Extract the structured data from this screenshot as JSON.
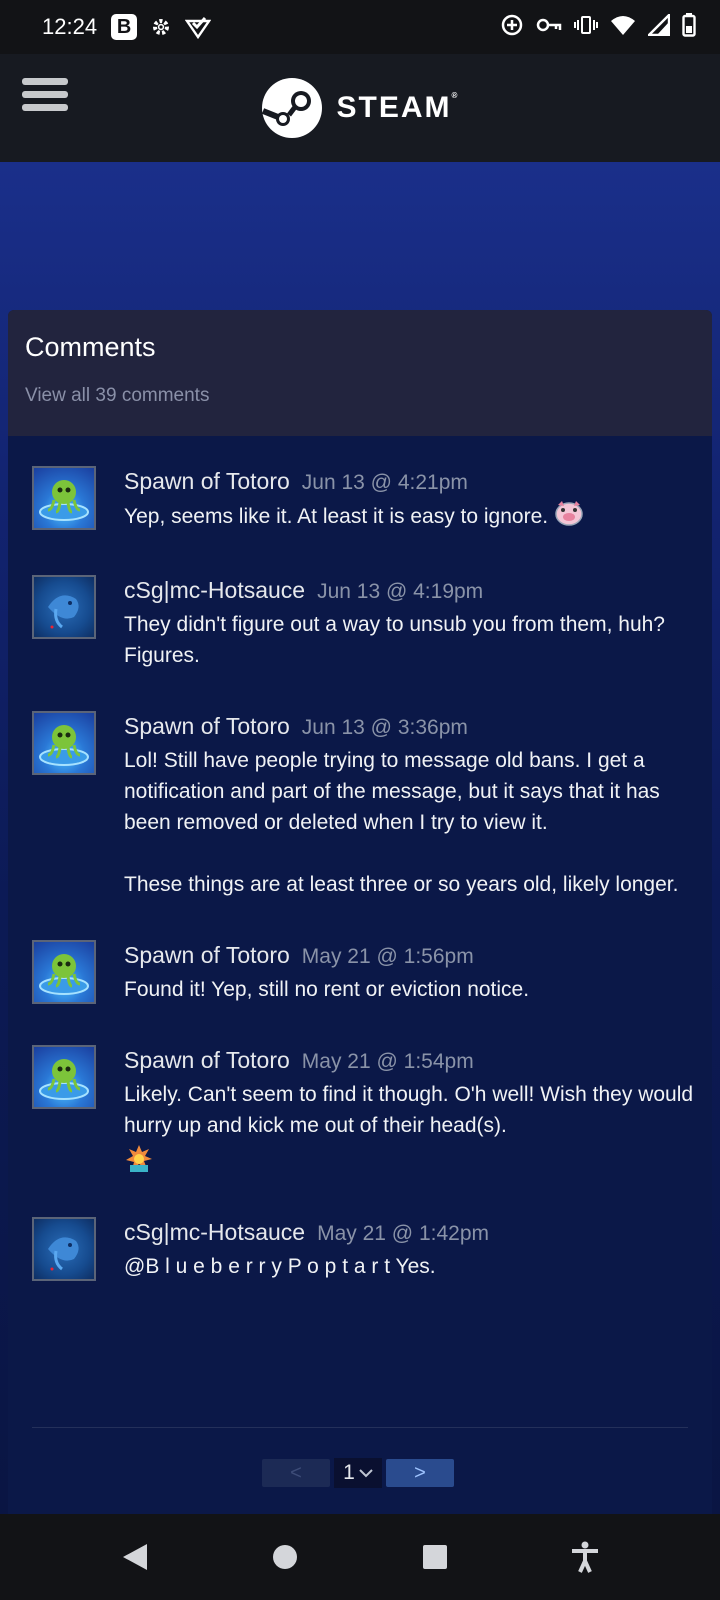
{
  "status_bar": {
    "time": "12:24",
    "badge": "B"
  },
  "header": {
    "logo_text": "STEAM",
    "logo_mark": "®"
  },
  "comments_panel": {
    "title": "Comments",
    "view_all": "View all 39 comments"
  },
  "comments": [
    {
      "author": "Spawn of Totoro",
      "date": "Jun 13 @ 4:21pm",
      "text": "Yep, seems like it. At least it is easy to ignore.",
      "avatar": "octopus-avatar",
      "emote": "pig-emote"
    },
    {
      "author": "cSg|mc-Hotsauce",
      "date": "Jun 13 @ 4:19pm",
      "text": "They didn't figure out a way to unsub you from them, huh? Figures.",
      "avatar": "fish-avatar"
    },
    {
      "author": "Spawn of Totoro",
      "date": "Jun 13 @ 3:36pm",
      "text": "Lol! Still have people trying to message old bans. I get a notification and part of the message, but it says that it has been removed or deleted when I try to view it.\n\nThese things are at least three or so years old, likely longer.",
      "avatar": "octopus-avatar"
    },
    {
      "author": "Spawn of Totoro",
      "date": "May 21 @ 1:56pm",
      "text": "Found it! Yep, still no rent or eviction notice.",
      "avatar": "octopus-avatar"
    },
    {
      "author": "Spawn of Totoro",
      "date": "May 21 @ 1:54pm",
      "text": "Likely. Can't seem to find it though. O'h well! Wish they would hurry up and kick me out of their head(s).",
      "avatar": "octopus-avatar",
      "emote": "explosion-emote"
    },
    {
      "author": "cSg|mc-Hotsauce",
      "date": "May 21 @ 1:42pm",
      "text": "@B l u e b e r r y P o p t a r t Yes.",
      "avatar": "fish-avatar"
    }
  ],
  "pager": {
    "prev": "<",
    "current": "1",
    "next": ">"
  },
  "colors": {
    "header_bg": "#171a21",
    "panel_head_bg": "#22243e",
    "panel_bg": "#0b1848",
    "date_text": "#8a93a8",
    "next_button": "#2a4b8e"
  }
}
